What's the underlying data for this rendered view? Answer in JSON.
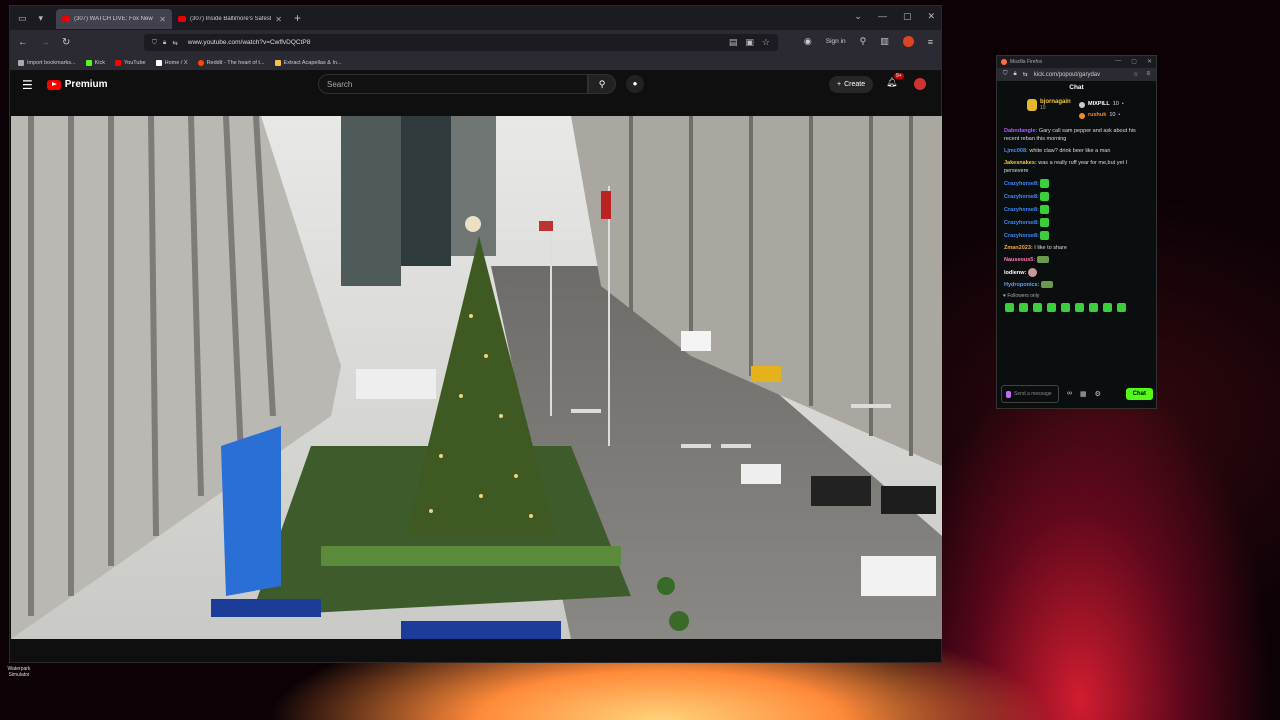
{
  "browser": {
    "tabs": [
      {
        "label": "(307) WATCH LIVE: Fox New",
        "active": true
      },
      {
        "label": "(307) Inside Baltimore's Safest",
        "active": false
      }
    ],
    "url": "www.youtube.com/watch?v=CwffvDQCtP8",
    "signin_label": "Sign in",
    "bookmarks": [
      {
        "label": "Import bookmarks...",
        "color": "#aaaaaa"
      },
      {
        "label": "Kick",
        "color": "#53fc18"
      },
      {
        "label": "YouTube",
        "color": "#ff0000"
      },
      {
        "label": "Home / X",
        "color": "#ffffff"
      },
      {
        "label": "Reddit - The heart of t...",
        "color": "#ff4500"
      },
      {
        "label": "Extract Acapellas & In...",
        "color": "#f5c542"
      }
    ]
  },
  "youtube": {
    "logo_text": "Premium",
    "search_placeholder": "Search",
    "create_label": "Create",
    "notification_count": "9+"
  },
  "chat_window": {
    "app_title": "Mozilla Firefox",
    "url": "kick.com/popout/garydav",
    "header": "Chat",
    "leaders": {
      "top": {
        "name": "bjornagain",
        "score": "10"
      },
      "second": {
        "name": "MIXPILL",
        "score": "10"
      },
      "third": {
        "name": "rushuk",
        "score": "10"
      }
    },
    "messages": [
      {
        "user": "Dabndangle:",
        "text": "Gary call sam pepper and ask about his recent reban this morning",
        "color": "#b05cff"
      },
      {
        "user": "Ljmc008:",
        "text": "white claw? drink beer like a man",
        "color": "#4f8cff"
      },
      {
        "user": "Jakesnakes:",
        "text": "was a really ruff year for me,but yet I persevere",
        "color": "#f5c442"
      },
      {
        "user": "Crazyhorse8:",
        "text": "",
        "color": "#3d8bff",
        "emote": "green"
      },
      {
        "user": "Crazyhorse8:",
        "text": "",
        "color": "#3d8bff",
        "emote": "green"
      },
      {
        "user": "Crazyhorse8:",
        "text": "",
        "color": "#3d8bff",
        "emote": "green"
      },
      {
        "user": "Crazyhorse8:",
        "text": "",
        "color": "#3d8bff",
        "emote": "green"
      },
      {
        "user": "Crazyhorse8:",
        "text": "",
        "color": "#3d8bff",
        "emote": "green"
      },
      {
        "user": "Zman2023:",
        "text": "I like to share",
        "color": "#f5a742"
      },
      {
        "user": "Nauseous5:",
        "text": "",
        "color": "#ff7ab8",
        "emote": "hat"
      },
      {
        "user": "lodienw:",
        "text": "",
        "color": "#ffffff",
        "emote": "face"
      },
      {
        "user": "Hydroponics:",
        "text": "",
        "color": "#5aa0ff",
        "emote": "hat"
      }
    ],
    "followers_only": "Followers only",
    "input_placeholder": "Send a message",
    "send_label": "Chat"
  },
  "desktop": {
    "icon_label": "Waterpark Simulator"
  }
}
